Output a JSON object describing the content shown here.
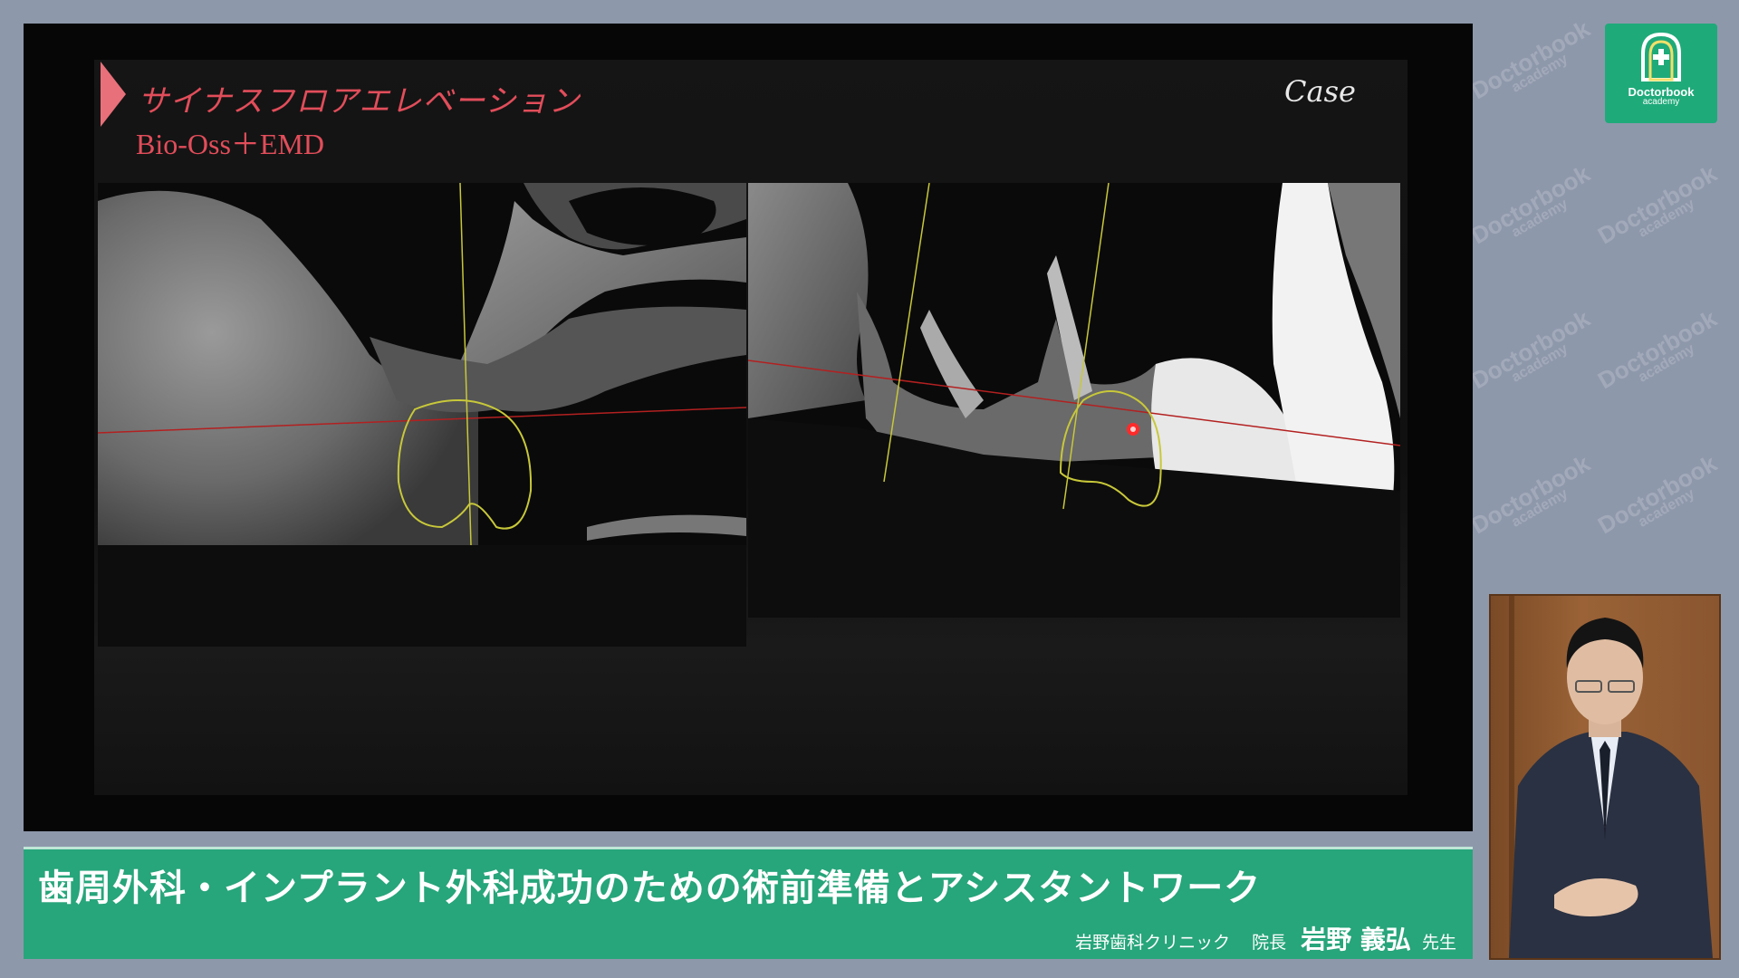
{
  "slide": {
    "title": "サイナスフロアエレベーション",
    "subtitle": "Bio-Oss＋EMD",
    "case_label": "Case"
  },
  "banner": {
    "title": "歯周外科・インプラント外科成功のための術前準備とアシスタントワーク",
    "clinic": "岩野歯科クリニック",
    "role": "院長",
    "presenter_name": "岩野 義弘",
    "honorific": "先生"
  },
  "logo": {
    "brand": "Doctorbook",
    "sub": "academy"
  },
  "colors": {
    "banner_green": "#27a57b",
    "title_red": "#e24d5a",
    "marker_pink": "#e8707a",
    "outline_yellow": "#c8c83a",
    "axis_red": "#b32020"
  }
}
